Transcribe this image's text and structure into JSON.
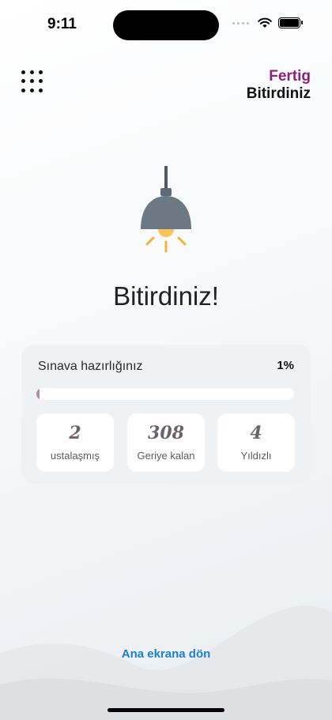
{
  "status": {
    "time": "9:11",
    "icons": [
      "signal-icon",
      "wifi-icon",
      "battery-icon"
    ]
  },
  "header": {
    "menu_icon": "grid-menu-icon",
    "language_top": "Fertig",
    "language_bottom": "Bitirdiniz"
  },
  "illustration": "lamp-icon",
  "headline": "Bitirdiniz!",
  "readiness": {
    "label": "Sınava hazırlığınız",
    "percent_text": "1%",
    "progress_fraction": 0.01
  },
  "stats": [
    {
      "value": "2",
      "label": "ustalaşmış"
    },
    {
      "value": "308",
      "label": "Geriye kalan"
    },
    {
      "value": "4",
      "label": "Yıldızlı"
    }
  ],
  "footer": {
    "home_link": "Ana ekrana dön"
  },
  "colors": {
    "accent_purple": "#8a1f7e",
    "link_blue": "#1f7fcf",
    "progress_fill": "#b58aa7",
    "card_bg": "#eef2f4"
  }
}
